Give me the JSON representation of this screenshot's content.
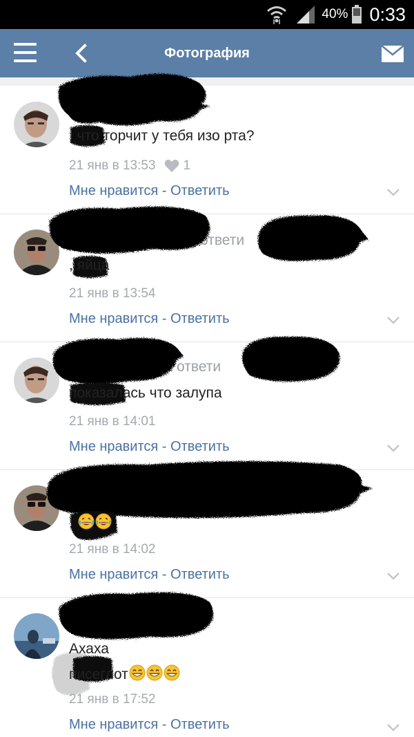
{
  "statusbar": {
    "battery": "40%",
    "time": "0:33"
  },
  "header": {
    "title": "Фотография"
  },
  "comments": [
    {
      "lines": [
        "        , что торчит у тебя изо рта?"
      ],
      "time": "21 янв в 13:53",
      "likes": "1",
      "like_label": "Мне нравится",
      "sep": " - ",
      "reply_label": "Ответить"
    },
    {
      "header_partial": "ответи",
      "lines": [
        "        , яйца"
      ],
      "time": "21 янв в 13:54",
      "like_label": "Мне нравится",
      "sep": " - ",
      "reply_label": "Ответить"
    },
    {
      "header_partial": "ответи",
      "lines": [
        "         показалась что залупа"
      ],
      "time": "21 янв в 14:01",
      "like_label": "Мне нравится",
      "sep": " - ",
      "reply_label": "Ответить"
    },
    {
      "lines": [
        "        , "
      ],
      "time": "21 янв в 14:02",
      "like_label": "Мне нравится",
      "sep": " - ",
      "reply_label": "Ответить"
    },
    {
      "lines": [
        "Ахаха",
        "        писеглот"
      ],
      "time": "21 янв в 17:52",
      "like_label": "Мне нравится",
      "sep": " - ",
      "reply_label": "Ответить"
    }
  ],
  "colors": {
    "topbar": "#5b7fa6",
    "link": "#4a72a0",
    "meta": "#a4a9b0",
    "text": "#222222"
  }
}
